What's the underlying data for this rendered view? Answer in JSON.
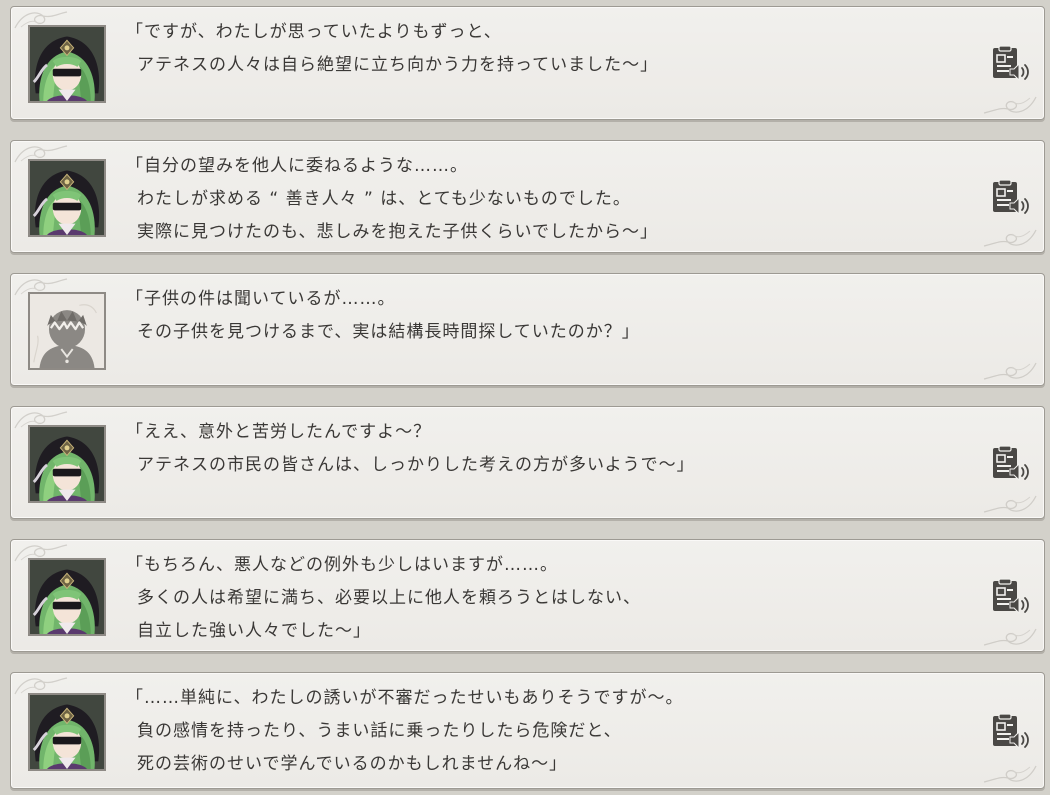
{
  "entries": [
    {
      "speaker": "green-haired-woman",
      "has_voice": true,
      "lines": [
        "「ですが、わたしが思っていたよりもずっと、",
        "アテネスの人々は自ら絶望に立ち向かう力を持っていました～」"
      ]
    },
    {
      "speaker": "green-haired-woman",
      "has_voice": true,
      "lines": [
        "「自分の望みを他人に委ねるような……。",
        "わたしが求める “ 善き人々 ” は、とても少ないものでした。",
        "実際に見つけたのも、悲しみを抱えた子供くらいでしたから～」"
      ]
    },
    {
      "speaker": "player-silhouette",
      "has_voice": false,
      "lines": [
        "「子供の件は聞いているが……。",
        "その子供を見つけるまで、実は結構長時間探していたのか？」"
      ]
    },
    {
      "speaker": "green-haired-woman",
      "has_voice": true,
      "lines": [
        "「ええ、意外と苦労したんですよ～？",
        "アテネスの市民の皆さんは、しっかりした考えの方が多いようで～」"
      ]
    },
    {
      "speaker": "green-haired-woman",
      "has_voice": true,
      "lines": [
        "「もちろん、悪人などの例外も少しはいますが……。",
        "多くの人は希望に満ち、必要以上に他人を頼ろうとはしない、",
        "自立した強い人々でした～」"
      ]
    },
    {
      "speaker": "green-haired-woman",
      "has_voice": true,
      "lines": [
        "「……単純に、わたしの誘いが不審だったせいもありそうですが～。",
        "負の感情を持ったり、うまい話に乗ったりしたら危険だと、",
        "死の芸術のせいで学んでいるのかもしれませんね～」"
      ]
    }
  ],
  "colors": {
    "background": "#d3d1ca",
    "panel": "#eeedea",
    "panel_border": "#9d9a93",
    "text": "#3a3836",
    "icon": "#4a4845"
  }
}
